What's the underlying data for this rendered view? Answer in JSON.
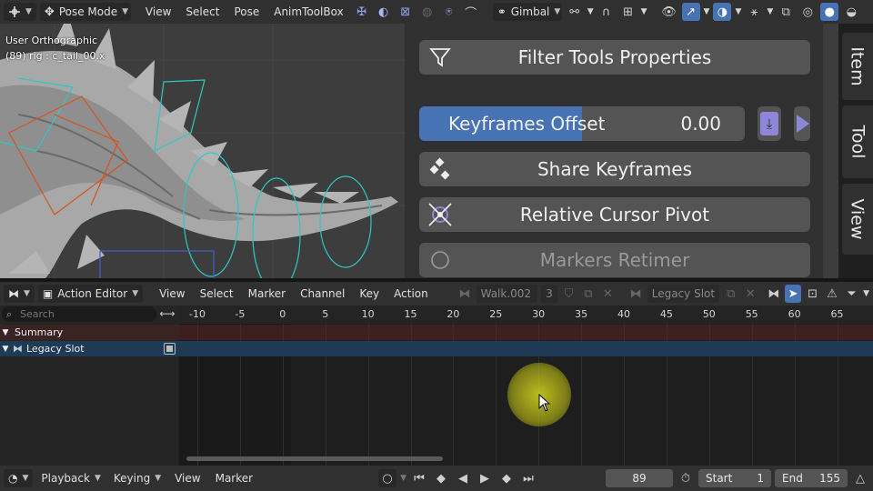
{
  "top_header": {
    "mode": "Pose Mode",
    "menus": [
      "View",
      "Select",
      "Pose",
      "AnimToolBox"
    ],
    "orientation": "Gimbal"
  },
  "viewport": {
    "view_name": "User Orthographic",
    "object_info": "(89) rig : c_tail_00.x"
  },
  "sidebar": {
    "filter_label": "Filter Tools Properties",
    "offset_label": "Keyframes Offset",
    "offset_value": "0.00",
    "offset_fill_fraction": 0.5,
    "share_label": "Share Keyframes",
    "pivot_label": "Relative Cursor Pivot",
    "markers_label": "Markers Retimer",
    "tabs": [
      "Item",
      "Tool",
      "View"
    ]
  },
  "action_editor": {
    "editor_type": "Action Editor",
    "menus": [
      "View",
      "Select",
      "Marker",
      "Channel",
      "Key",
      "Action"
    ],
    "action_name": "Walk.002",
    "action_users": "3",
    "slot_name": "Legacy Slot",
    "search_placeholder": "Search",
    "channels": {
      "summary": "Summary",
      "legacy_slot": "Legacy Slot"
    },
    "ruler_ticks": [
      "-10",
      "-5",
      "0",
      "5",
      "10",
      "15",
      "20",
      "25",
      "30",
      "35",
      "40",
      "45",
      "50",
      "55",
      "60",
      "65"
    ]
  },
  "timeline_header": {
    "menus": [
      "Playback",
      "Keying",
      "View",
      "Marker"
    ],
    "current_frame": "89",
    "start_label": "Start",
    "start_value": "1",
    "end_label": "End",
    "end_value": "155"
  },
  "colors": {
    "accent": "#4772b3",
    "summary_row": "#3a2323",
    "slot_row": "#1f3a55",
    "cursor_highlight": "#d8d820"
  }
}
